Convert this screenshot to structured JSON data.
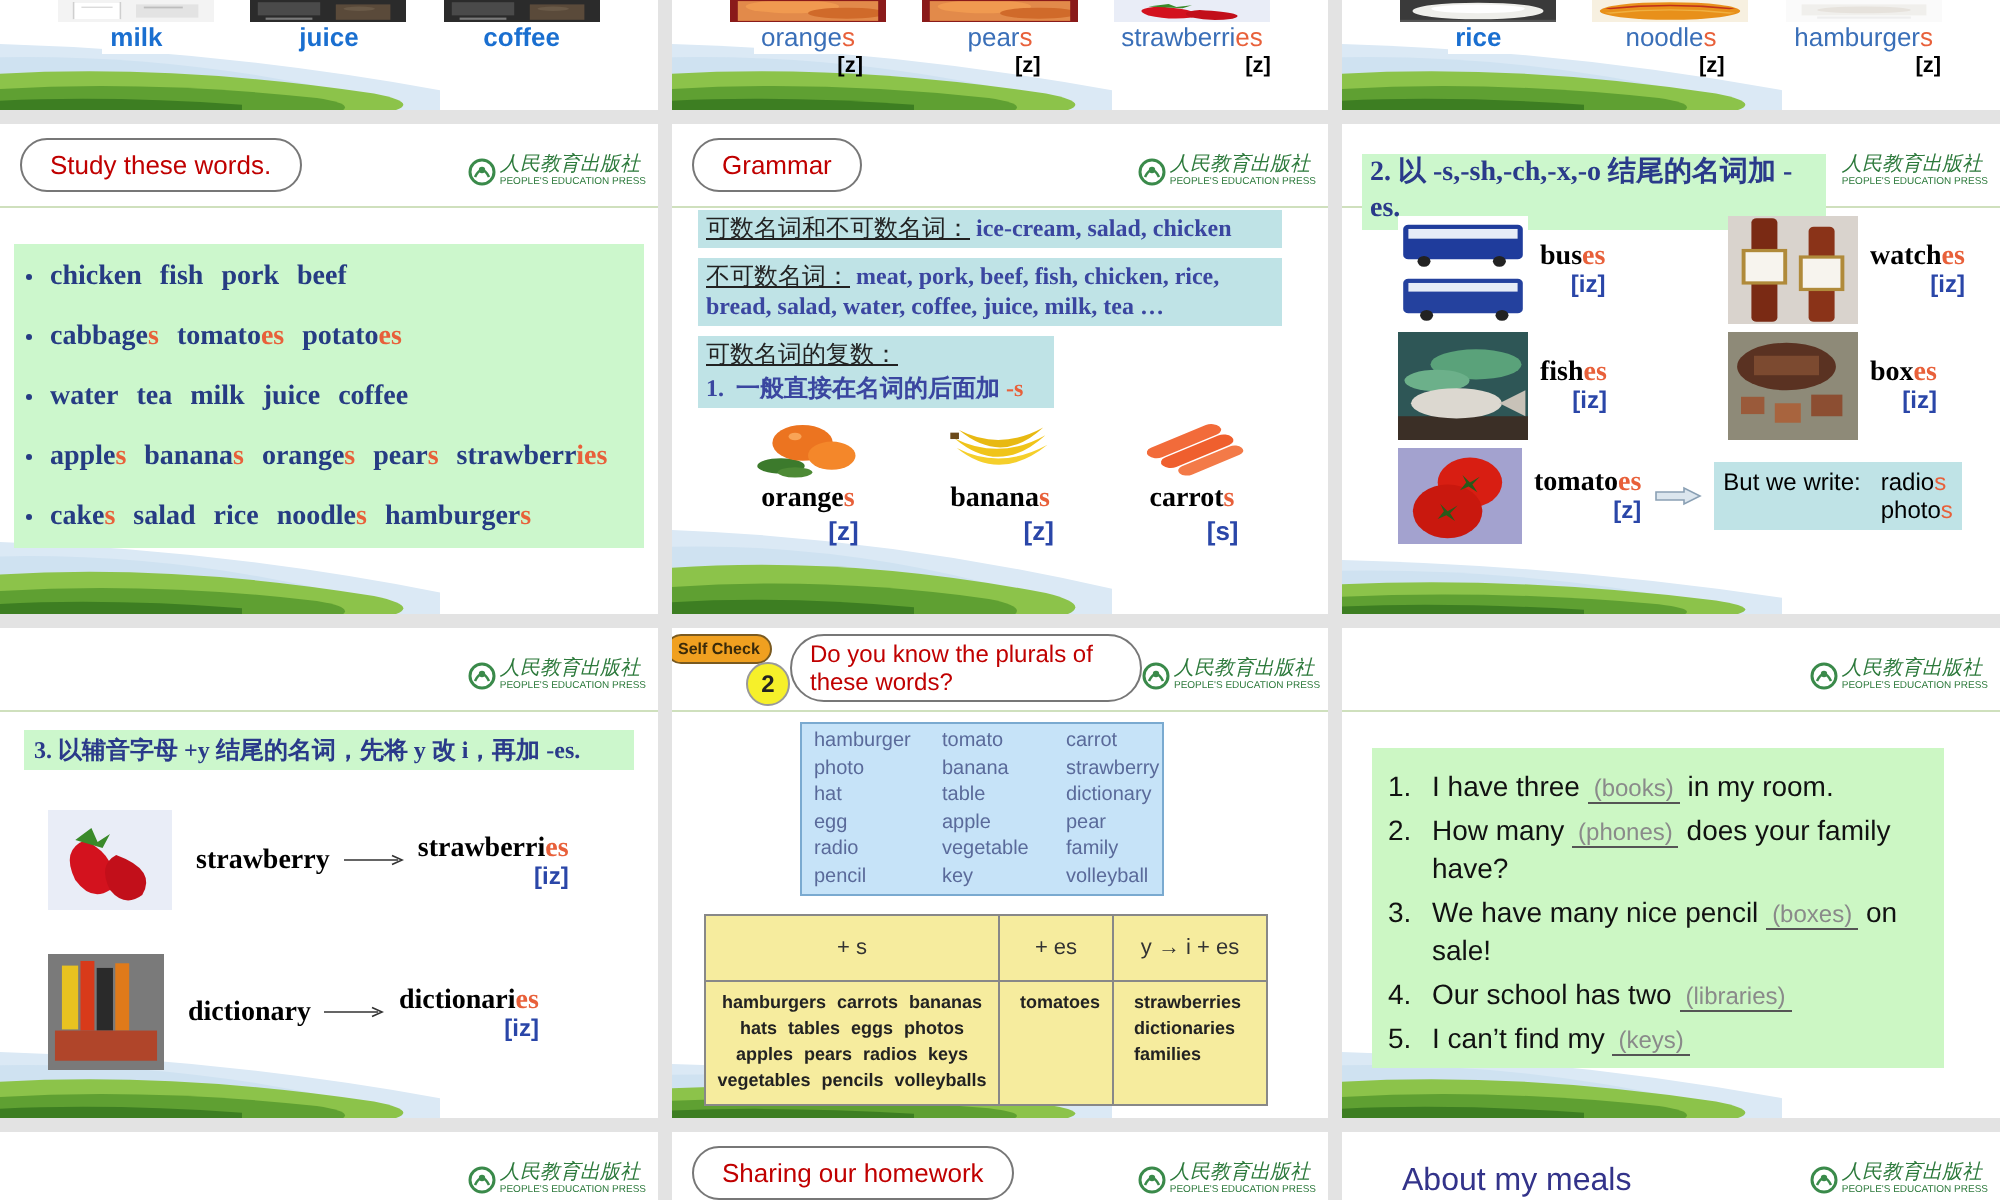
{
  "slides": [
    {
      "kind": "picture_words",
      "items": [
        {
          "stem": "milk"
        },
        {
          "stem": "juice"
        },
        {
          "stem": "coffee"
        }
      ]
    },
    {
      "kind": "picture_words",
      "items": [
        {
          "stem": "orange",
          "suffix": "s",
          "sound": "[z]"
        },
        {
          "stem": "pear",
          "suffix": "s",
          "sound": "[z]"
        },
        {
          "stem": "strawberri",
          "suffix": "es",
          "sound": "[z]"
        }
      ]
    },
    {
      "kind": "picture_words",
      "items": [
        {
          "stem": "rice"
        },
        {
          "stem": "noodle",
          "suffix": "s",
          "sound": "[z]"
        },
        {
          "stem": "hamburger",
          "suffix": "s",
          "sound": "[z]"
        }
      ]
    },
    {
      "kind": "word_list",
      "title": "Study these words.",
      "logo": {
        "emblem": true,
        "name": "人民教育出版社",
        "name_en": "PEOPLE'S EDUCATION PRESS"
      },
      "lines": [
        [
          {
            "stem": "chicken"
          },
          {
            "stem": "fish"
          },
          {
            "stem": "pork"
          },
          {
            "stem": "beef"
          }
        ],
        [
          {
            "stem": "cabbage",
            "suffix": "s"
          },
          {
            "stem": "tomato",
            "suffix": "es"
          },
          {
            "stem": "potato",
            "suffix": "es"
          }
        ],
        [
          {
            "stem": "water"
          },
          {
            "stem": "tea"
          },
          {
            "stem": "milk"
          },
          {
            "stem": "juice"
          },
          {
            "stem": "coffee"
          }
        ],
        [
          {
            "stem": "apple",
            "suffix": "s"
          },
          {
            "stem": "banana",
            "suffix": "s"
          },
          {
            "stem": "orange",
            "suffix": "s"
          },
          {
            "stem": "pear",
            "suffix": "s"
          },
          {
            "stem": "strawberr",
            "suffix": "ies"
          }
        ],
        [
          {
            "stem": "cake",
            "suffix": "s"
          },
          {
            "stem": "salad"
          },
          {
            "stem": "rice"
          },
          {
            "stem": "noodle",
            "suffix": "s"
          },
          {
            "stem": "hamburger",
            "suffix": "s"
          }
        ]
      ]
    },
    {
      "kind": "grammar",
      "title": "Grammar",
      "logo": {
        "emblem": true,
        "name": "人民教育出版社",
        "name_en": "PEOPLE'S EDUCATION PRESS"
      },
      "boxes": [
        {
          "label": "可数名词和不可数名词：",
          "text": "ice-cream, salad, chicken"
        },
        {
          "label": "不可数名词：",
          "text": "meat, pork, beef, fish, chicken, rice, bread, salad, water, coffee, juice, milk, tea …"
        },
        {
          "label": "可数名词的复数：",
          "rule": "1.  一般直接在名词的后面加 ",
          "suffix": "-s"
        }
      ],
      "items": [
        {
          "stem": "orange",
          "suffix": "s",
          "sound": "[z]"
        },
        {
          "stem": "banana",
          "suffix": "s",
          "sound": "[z]"
        },
        {
          "stem": "carrot",
          "suffix": "s",
          "sound": "[s]"
        }
      ]
    },
    {
      "kind": "es_rule",
      "rule": "2. 以 -s,-sh,-ch,-x,-o 结尾的名词加 -es.",
      "logo": {
        "emblem": false,
        "name": "人民教育出版社",
        "name_en": "PEOPLE'S EDUCATION PRESS"
      },
      "items": [
        {
          "stem": "bus",
          "suffix": "es",
          "sound": "[iz]"
        },
        {
          "stem": "watch",
          "suffix": "es",
          "sound": "[iz]"
        },
        {
          "stem": "fish",
          "suffix": "es",
          "sound": "[iz]"
        },
        {
          "stem": "box",
          "suffix": "es",
          "sound": "[iz]"
        },
        {
          "stem": "tomato",
          "suffix": "es",
          "sound": "[z]"
        }
      ],
      "note": {
        "label": "But we write:",
        "words": [
          {
            "stem": "radio",
            "suffix": "s"
          },
          {
            "stem": "photo",
            "suffix": "s"
          }
        ]
      }
    },
    {
      "kind": "y_rule",
      "rule": "3. 以辅音字母 +y 结尾的名词，先将 y 改 i，再加 -es.",
      "logo": {
        "emblem": true,
        "name": "人民教育出版社",
        "name_en": "PEOPLE'S EDUCATION PRESS"
      },
      "items": [
        {
          "word": "strawberry",
          "stem": "strawberri",
          "suffix": "es",
          "sound": "[iz]"
        },
        {
          "word": "dictionary",
          "stem": "dictionari",
          "suffix": "es",
          "sound": "[iz]"
        }
      ]
    },
    {
      "kind": "self_check",
      "badge": "Self Check",
      "number": "2",
      "title": "Do you know the plurals of these words?",
      "logo": {
        "emblem": true,
        "name": "人民教育出版社",
        "name_en": "PEOPLE'S EDUCATION PRESS"
      },
      "words": [
        "hamburger",
        "tomato",
        "carrot",
        "photo",
        "banana",
        "strawberry",
        "hat",
        "table",
        "dictionary",
        "egg",
        "apple",
        "pear",
        "radio",
        "vegetable",
        "family",
        "pencil",
        "key",
        "volleyball"
      ],
      "table": {
        "columns": [
          "+ s",
          "+ es",
          "y → i + es"
        ],
        "cells": [
          [
            "hamburgers carrots bananas",
            "hats tables eggs photos",
            "apples pears radios keys",
            "vegetables pencils volleyballs"
          ],
          [
            "tomatoes"
          ],
          [
            "strawberries",
            "dictionaries",
            "families"
          ]
        ]
      }
    },
    {
      "kind": "exercise",
      "logo": {
        "emblem": true,
        "name": "人民教育出版社",
        "name_en": "PEOPLE'S EDUCATION PRESS"
      },
      "items": [
        {
          "number": "1.",
          "before": "I have three",
          "answer": "(books)",
          "after": "in my room."
        },
        {
          "number": "2.",
          "before": "How many",
          "answer": "(phones)",
          "after": "does your family have?"
        },
        {
          "number": "3.",
          "before": "We have many nice pencil",
          "answer": "(boxes)",
          "after": "on sale!"
        },
        {
          "number": "4.",
          "before": "Our school has two",
          "answer": "(libraries)"
        },
        {
          "number": "5.",
          "before": "I can’t find my",
          "answer": "(keys)"
        }
      ]
    },
    {
      "kind": "header_only",
      "logo": {
        "emblem": true,
        "name": "人民教育出版社",
        "name_en": "PEOPLE'S EDUCATION PRESS"
      }
    },
    {
      "kind": "header_only",
      "title": "Sharing our homework",
      "logo": {
        "emblem": true,
        "name": "人民教育出版社",
        "name_en": "PEOPLE'S EDUCATION PRESS"
      }
    },
    {
      "kind": "header_only",
      "heading": "About my meals",
      "logo": {
        "emblem": true,
        "name": "人民教育出版社",
        "name_en": "PEOPLE'S EDUCATION PRESS"
      }
    }
  ]
}
